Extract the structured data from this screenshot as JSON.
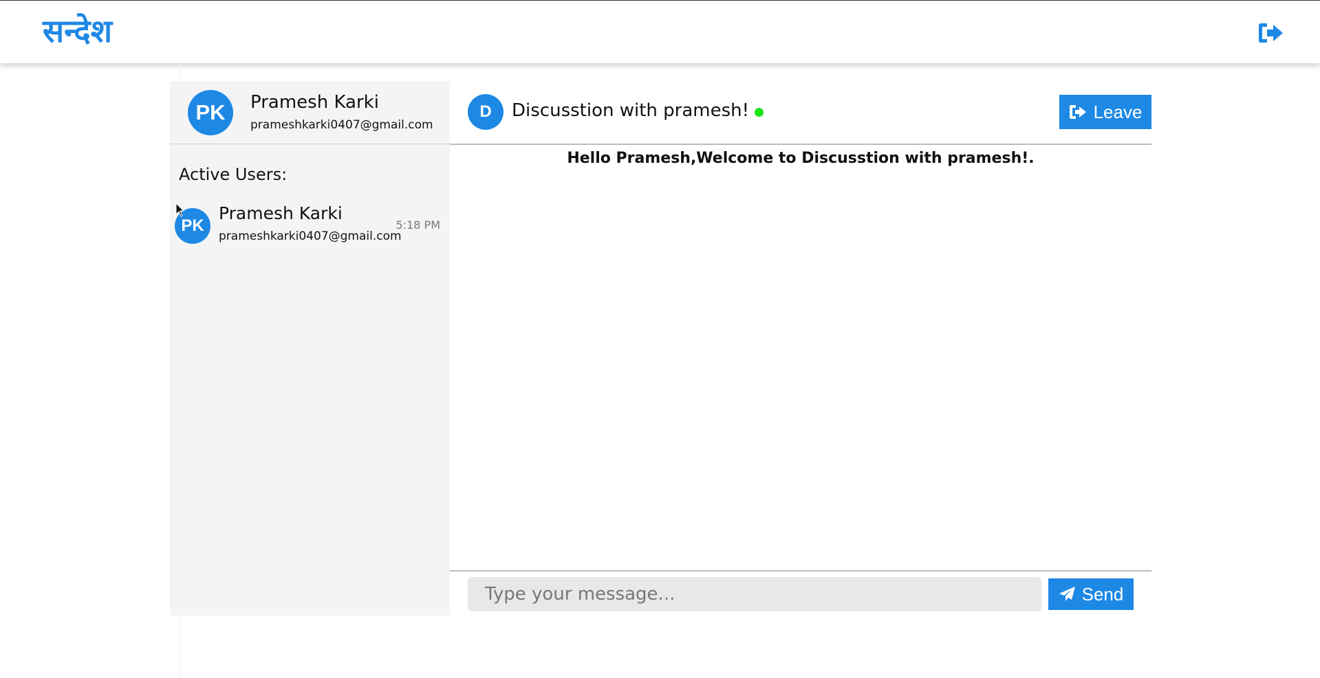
{
  "app": {
    "logo": "सन्देश",
    "logout_icon": "logout-icon"
  },
  "profile": {
    "initials": "PK",
    "name": "Pramesh Karki",
    "email": "prameshkarki0407@gmail.com"
  },
  "sidebar": {
    "active_title": "Active Users:",
    "users": [
      {
        "initials": "PK",
        "name": "Pramesh Karki",
        "email": "prameshkarki0407@gmail.com",
        "time": "5:18 PM"
      }
    ]
  },
  "room": {
    "initial": "D",
    "title": "Discusstion with pramesh!",
    "status_color": "#19e619",
    "leave_label": "Leave"
  },
  "messages": {
    "welcome": "Hello Pramesh,Welcome to Discusstion with pramesh!."
  },
  "composer": {
    "placeholder": "Type your message...",
    "send_label": "Send"
  },
  "theme": {
    "accent": "#1e88e5"
  }
}
